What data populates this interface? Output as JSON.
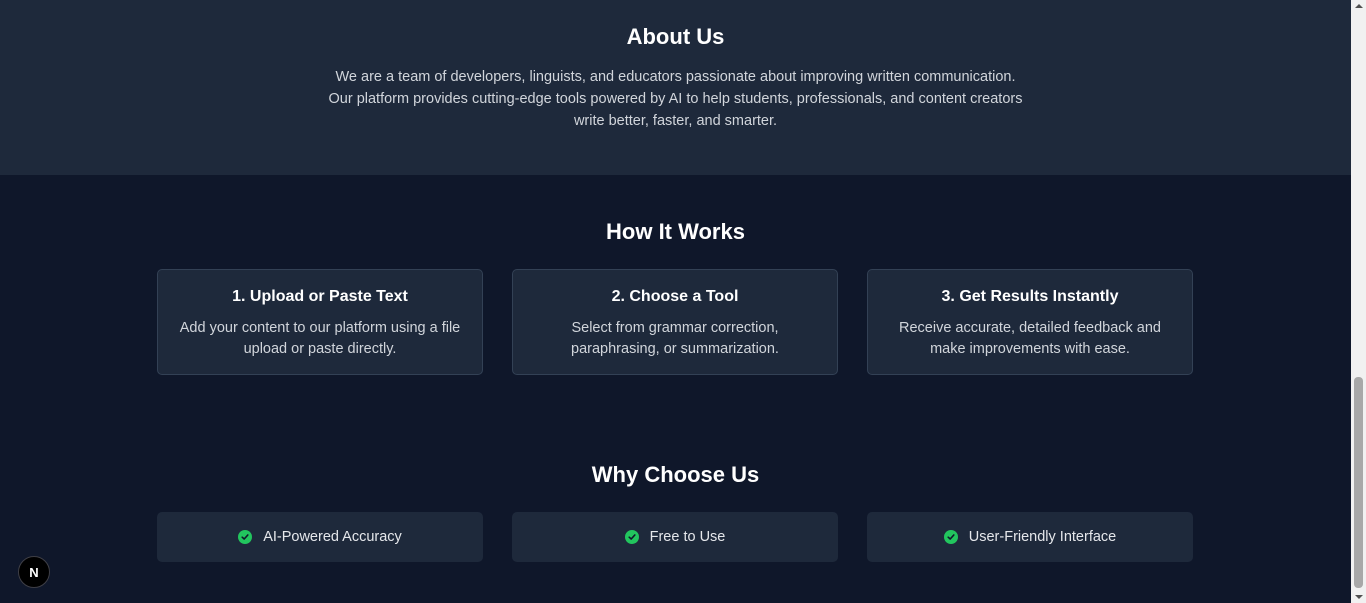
{
  "about": {
    "title": "About Us",
    "text": "We are a team of developers, linguists, and educators passionate about improving written communication. Our platform provides cutting-edge tools powered by AI to help students, professionals, and content creators write better, faster, and smarter."
  },
  "how_it_works": {
    "title": "How It Works",
    "steps": [
      {
        "title": "1. Upload or Paste Text",
        "text": "Add your content to our platform using a file upload or paste directly."
      },
      {
        "title": "2. Choose a Tool",
        "text": "Select from grammar correction, paraphrasing, or summarization."
      },
      {
        "title": "3. Get Results Instantly",
        "text": "Receive accurate, detailed feedback and make improvements with ease."
      }
    ]
  },
  "why_choose_us": {
    "title": "Why Choose Us",
    "features": [
      {
        "label": "AI-Powered Accuracy",
        "icon": "check-circle-icon"
      },
      {
        "label": "Free to Use",
        "icon": "check-circle-icon"
      },
      {
        "label": "User-Friendly Interface",
        "icon": "check-circle-icon"
      }
    ]
  },
  "dev_badge": {
    "label": "N",
    "icon": "nextjs-logo-icon"
  },
  "colors": {
    "background": "#0f172a",
    "section_alt": "#1e293b",
    "accent_check": "#22c55e",
    "border": "#334155"
  }
}
